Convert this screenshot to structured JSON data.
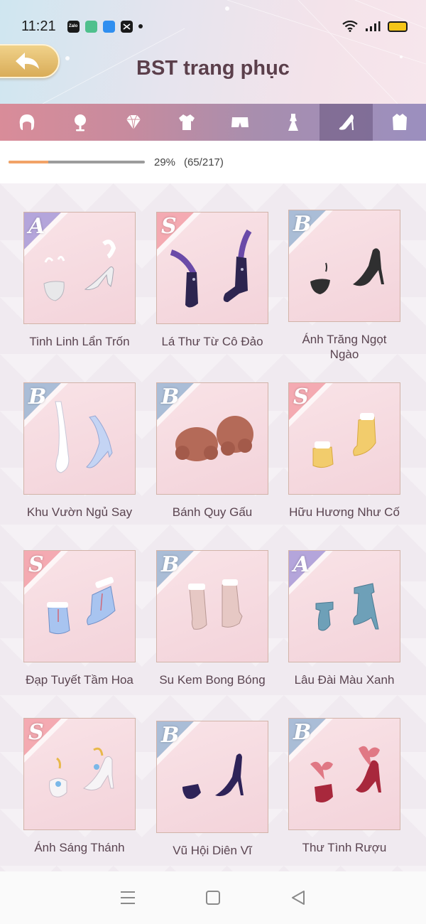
{
  "status_bar": {
    "time": "11:21",
    "notification_icons": [
      "zalo-icon",
      "app-green-icon",
      "app-blue-icon",
      "capcut-icon",
      "dot-icon"
    ],
    "zalo_label": "Zalo",
    "system_icons": [
      "wifi-icon",
      "signal-icon",
      "battery-icon"
    ]
  },
  "header": {
    "title": "BST trang phục",
    "back_icon": "back-arrow-icon"
  },
  "tabs": [
    {
      "icon": "hair-icon",
      "active": false
    },
    {
      "icon": "mirror-icon",
      "active": false
    },
    {
      "icon": "diamond-icon",
      "active": false
    },
    {
      "icon": "jacket-icon",
      "active": false
    },
    {
      "icon": "shorts-icon",
      "active": false
    },
    {
      "icon": "dress-icon",
      "active": false
    },
    {
      "icon": "high-heel-icon",
      "active": true
    },
    {
      "icon": "coat-icon",
      "active": false
    }
  ],
  "progress": {
    "percent_label": "29%",
    "count_label": "(65/217)",
    "fraction": 0.29
  },
  "items": [
    {
      "name": "Tinh Linh Lẩn Trốn",
      "rank": "A"
    },
    {
      "name": "Lá Thư Từ Cô Đảo",
      "rank": "S"
    },
    {
      "name": "Ánh Trăng Ngọt Ngào",
      "rank": "B"
    },
    {
      "name": "Khu Vườn Ngủ Say",
      "rank": "B"
    },
    {
      "name": "Bánh Quy Gấu",
      "rank": "B"
    },
    {
      "name": "Hữu Hương Như Cố",
      "rank": "S"
    },
    {
      "name": "Đạp Tuyết Tầm Hoa",
      "rank": "S"
    },
    {
      "name": "Su Kem Bong Bóng",
      "rank": "B"
    },
    {
      "name": "Lâu Đài Màu Xanh",
      "rank": "A"
    },
    {
      "name": "Ánh Sáng Thánh",
      "rank": "S"
    },
    {
      "name": "Vũ Hội Diên Vĩ",
      "rank": "B"
    },
    {
      "name": "Thư Tình Rượu",
      "rank": "B"
    }
  ],
  "rank_colors": {
    "A": "#a89ad8",
    "S": "#f3a0a8",
    "B": "#9cb6d4"
  },
  "navbar": {
    "icons": [
      "menu-icon",
      "home-square-icon",
      "back-triangle-icon"
    ]
  }
}
